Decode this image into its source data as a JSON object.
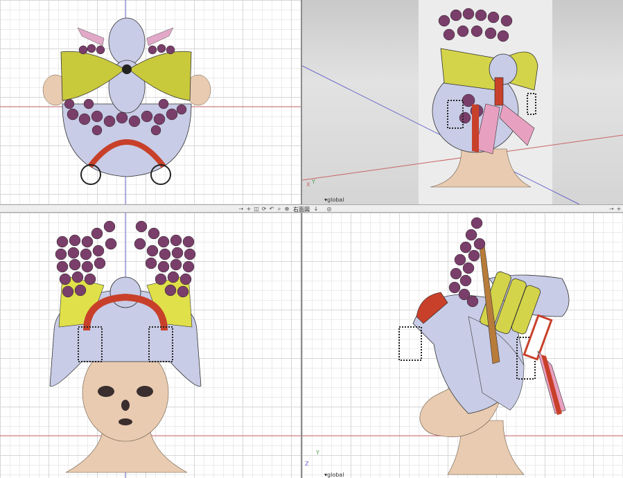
{
  "toolbar": {
    "icons": [
      "move-icon",
      "plus-icon",
      "frame-icon",
      "rotate-icon",
      "undo-icon",
      "zoom-icon",
      "fit-icon"
    ],
    "view_label": "右面図",
    "view_suffix": "↓",
    "target_icon": "target-icon"
  },
  "viewports": {
    "perspective": {
      "axis_label": "▾global"
    },
    "right": {
      "axis_label": "▾global"
    }
  },
  "axes": {
    "x": "X",
    "y": "Y",
    "z": "Z"
  },
  "colors": {
    "grid_major": "#d6d6d6",
    "grid_minor": "#ebebeb",
    "axis_red": "#c86464",
    "axis_blue": "#6464c8",
    "hair_white": "#c8cce6",
    "bow_yellow": "#d4d44a",
    "flower_purple": "#7a3e6a",
    "skin": "#e8cbb0",
    "comb_red": "#c8402a",
    "ribbon_pink": "#e8a0c0"
  }
}
